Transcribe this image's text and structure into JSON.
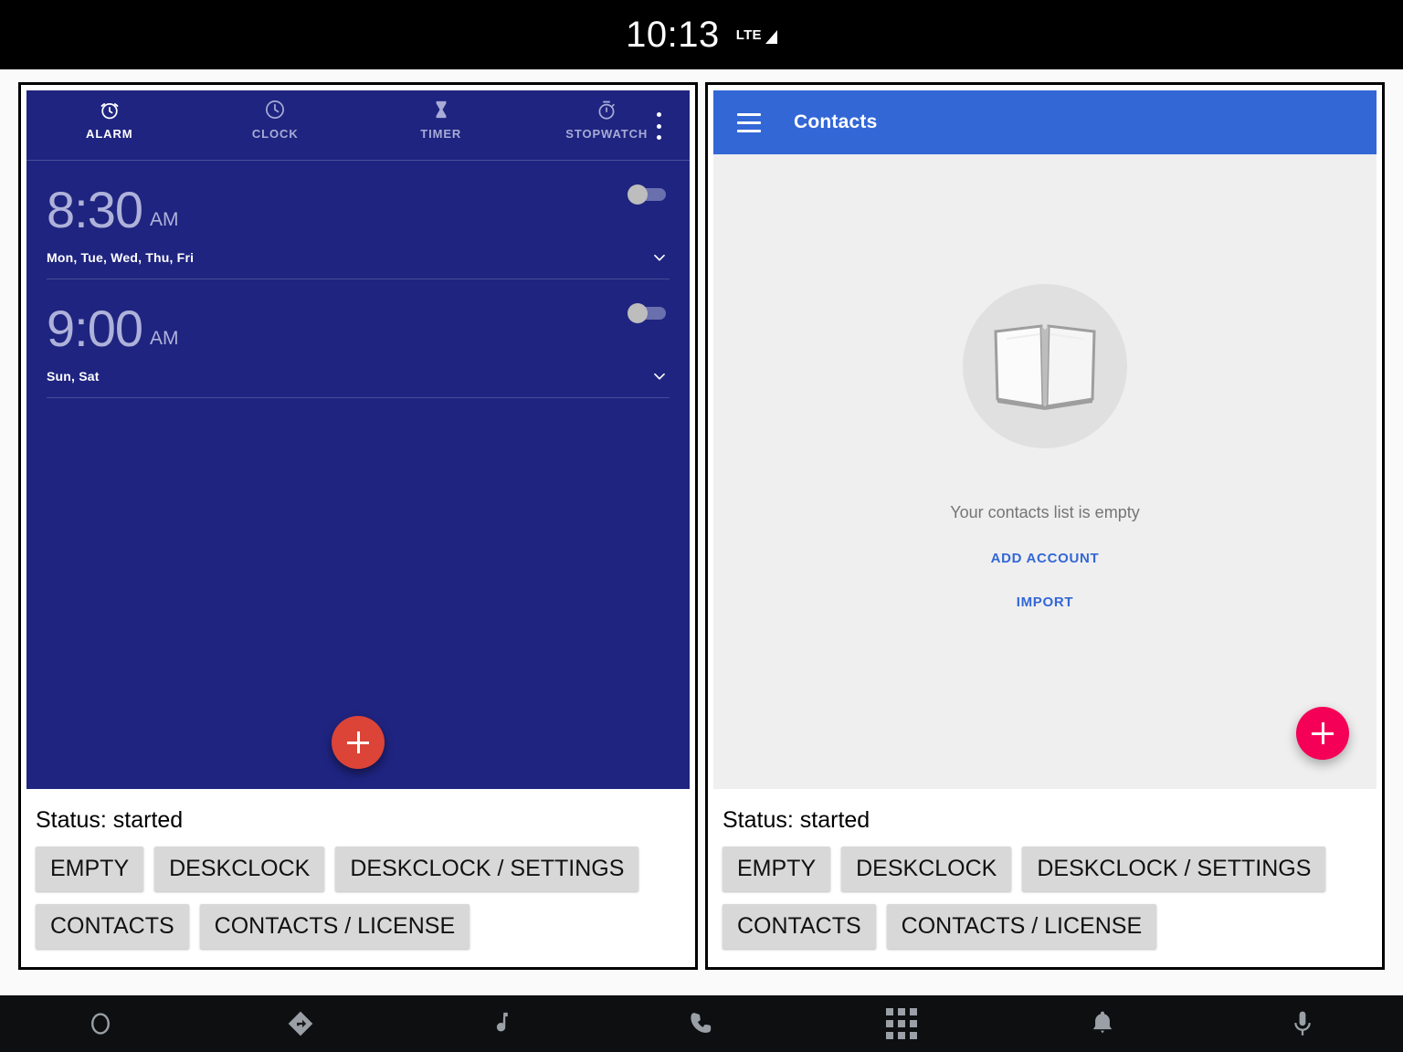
{
  "status_bar": {
    "time": "10:13",
    "network_label": "LTE",
    "signal_icon": "signal-triangle-icon"
  },
  "clock_app": {
    "tabs": [
      {
        "label": "ALARM",
        "icon": "alarm-clock-icon",
        "active": true
      },
      {
        "label": "CLOCK",
        "icon": "clock-icon",
        "active": false
      },
      {
        "label": "TIMER",
        "icon": "hourglass-icon",
        "active": false
      },
      {
        "label": "STOPWATCH",
        "icon": "stopwatch-icon",
        "active": false
      }
    ],
    "overflow_icon": "more-vert-icon",
    "alarms": [
      {
        "time": "8:30",
        "meridiem": "AM",
        "days": "Mon, Tue, Wed, Thu, Fri",
        "enabled": false
      },
      {
        "time": "9:00",
        "meridiem": "AM",
        "days": "Sun, Sat",
        "enabled": false
      }
    ],
    "fab": {
      "icon": "plus-icon",
      "color": "#db4437"
    }
  },
  "contacts_app": {
    "menu_icon": "hamburger-menu-icon",
    "title": "Contacts",
    "empty_illustration": "open-book-icon",
    "empty_message": "Your contacts list is empty",
    "actions": [
      {
        "label": "ADD ACCOUNT"
      },
      {
        "label": "IMPORT"
      }
    ],
    "fab": {
      "icon": "plus-icon",
      "color": "#f50057"
    }
  },
  "controls": {
    "status_label": "Status: started",
    "buttons_row1": [
      {
        "label": "EMPTY"
      },
      {
        "label": "DESKCLOCK"
      },
      {
        "label": "DESKCLOCK / SETTINGS"
      }
    ],
    "buttons_row2": [
      {
        "label": "CONTACTS"
      },
      {
        "label": "CONTACTS / LICENSE"
      }
    ]
  },
  "bottom_nav": [
    {
      "icon": "home-circle-icon"
    },
    {
      "icon": "navigation-arrow-icon"
    },
    {
      "icon": "music-note-icon"
    },
    {
      "icon": "phone-icon"
    },
    {
      "icon": "apps-grid-icon"
    },
    {
      "icon": "bell-icon"
    },
    {
      "icon": "microphone-icon"
    }
  ]
}
